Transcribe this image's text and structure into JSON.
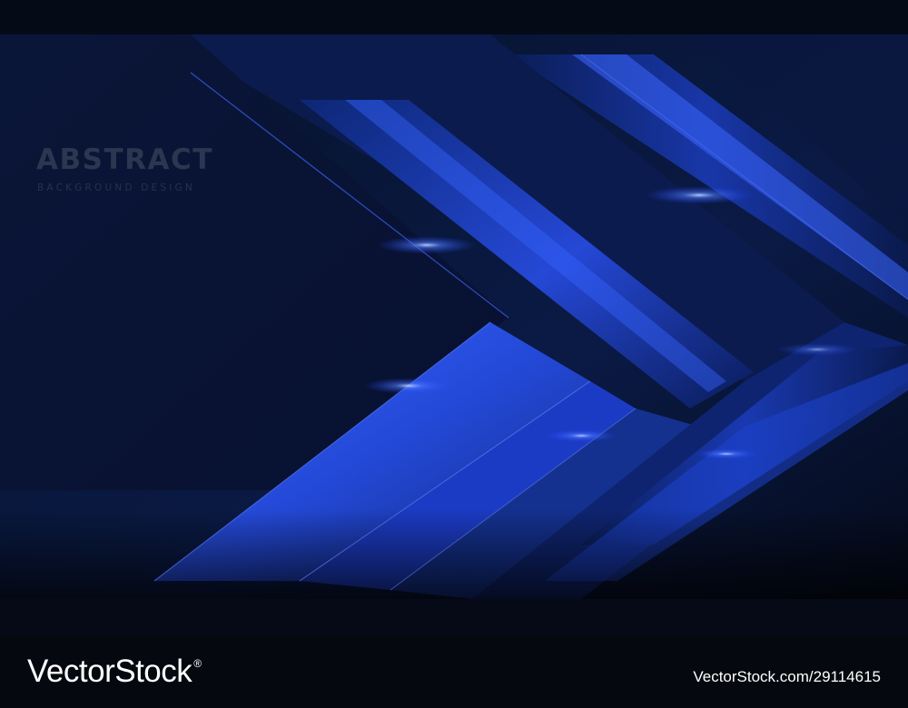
{
  "artwork": {
    "title": "ABSTRACT",
    "subtitle": "BACKGROUND DESIGN",
    "colors": {
      "background": "#060b18",
      "panel_dark": "#08142f",
      "panel_mid": "#0c2268",
      "accent_blue": "#2f5dff",
      "highlight": "#a9c2ff",
      "title_text": "#2b3750"
    }
  },
  "footer": {
    "brand": "VectorStock",
    "brand_mark": "®",
    "asset_id": "VectorStock.com/29114615",
    "background": "#05080f"
  }
}
